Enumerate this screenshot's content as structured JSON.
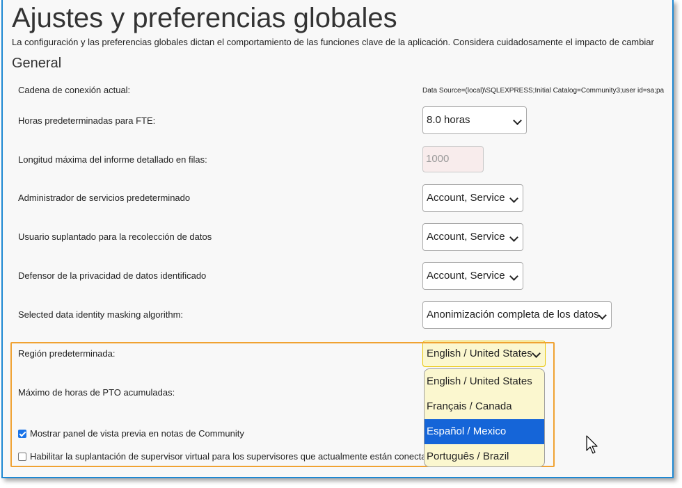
{
  "page": {
    "title": "Ajustes y preferencias globales",
    "description": "La configuración y las preferencias globales dictan el comportamiento de las funciones clave de la aplicación. Considera cuidadosamente el impacto de cambiar",
    "section": "General"
  },
  "settings": {
    "connection": {
      "label": "Cadena de conexión actual:",
      "value": "Data Source=(local)\\SQLEXPRESS;Initial Catalog=Community3;user id=sa;pa"
    },
    "fte_hours": {
      "label": "Horas predeterminadas para FTE:",
      "value": "8.0 horas"
    },
    "max_report_rows": {
      "label": "Longitud máxima del informe detallado en filas:",
      "placeholder": "1000"
    },
    "service_admin": {
      "label": "Administrador de servicios predeterminado",
      "value": "Account, Service"
    },
    "impersonated_user": {
      "label": "Usuario suplantado para la recolección de datos",
      "value": "Account, Service"
    },
    "privacy_advocate": {
      "label": "Defensor de la privacidad de datos identificado",
      "value": "Account, Service"
    },
    "masking_algorithm": {
      "label": "Selected data identity masking algorithm:",
      "value": "Anonimización completa de los datos"
    },
    "default_region": {
      "label": "Región predeterminada:",
      "value": "English / United States",
      "options": [
        "English / United States",
        "Français / Canada",
        "Español / Mexico",
        "Português / Brazil"
      ],
      "highlighted_index": 2
    },
    "max_pto": {
      "label": "Máximo de horas de PTO acumuladas:"
    },
    "show_preview": {
      "label": "Mostrar panel de vista previa en notas de Community",
      "checked": true
    },
    "virtual_supervisor": {
      "label": "Habilitar la suplantación de supervisor virtual para los supervisores que actualmente están conectados",
      "checked": false
    }
  },
  "colors": {
    "frame_border": "#1e88d2",
    "highlight_border": "#f0a232",
    "dropdown_background": "#fbf7cf",
    "selected_option": "#1565d8"
  },
  "icons": {
    "dropdown_arrow": "chevron-down-icon",
    "checkbox_checked": "check-icon",
    "cursor": "mouse-pointer-icon"
  }
}
